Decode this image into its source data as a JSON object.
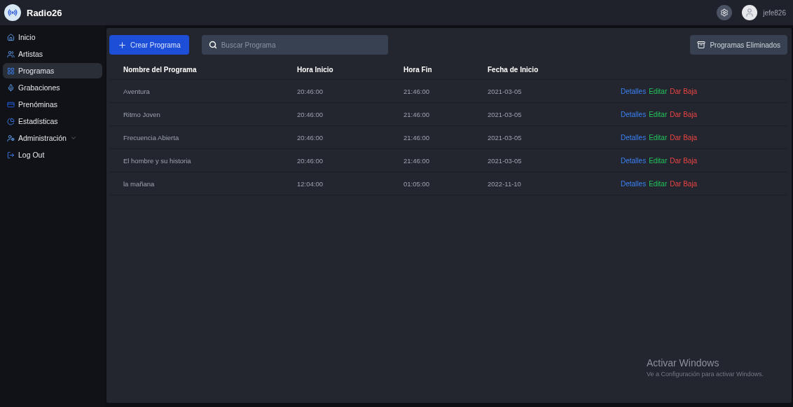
{
  "app": {
    "title": "Radio26"
  },
  "user": {
    "name": "jefe826"
  },
  "sidebar": {
    "items": [
      {
        "label": "Inicio",
        "selected": false
      },
      {
        "label": "Artistas",
        "selected": false
      },
      {
        "label": "Programas",
        "selected": true
      },
      {
        "label": "Grabaciones",
        "selected": false
      },
      {
        "label": "Prenóminas",
        "selected": false
      },
      {
        "label": "Estadísticas",
        "selected": false
      },
      {
        "label": "Administración",
        "selected": false,
        "expandable": true
      },
      {
        "label": "Log Out",
        "selected": false
      }
    ]
  },
  "toolbar": {
    "create_button": "Crear Programa",
    "search": {
      "placeholder": "Buscar Programa"
    },
    "deleted_button": "Programas Eliminados"
  },
  "table": {
    "columns": [
      "Nombre del Programa",
      "Hora Inicio",
      "Hora Fin",
      "Fecha de Inicio"
    ],
    "rows": [
      {
        "cells": [
          "Aventura",
          "20:46:00",
          "21:46:00",
          "2021-03-05"
        ],
        "actions": [
          "Detalles",
          "Editar",
          "Dar Baja"
        ]
      },
      {
        "cells": [
          "Ritmo Joven",
          "20:46:00",
          "21:46:00",
          "2021-03-05"
        ],
        "actions": [
          "Detalles",
          "Editar",
          "Dar Baja"
        ]
      },
      {
        "cells": [
          "Frecuencia Abierta",
          "20:46:00",
          "21:46:00",
          "2021-03-05"
        ],
        "actions": [
          "Detalles",
          "Editar",
          "Dar Baja"
        ]
      },
      {
        "cells": [
          "El hombre y su historia",
          "20:46:00",
          "21:46:00",
          "2021-03-05"
        ],
        "actions": [
          "Detalles",
          "Editar",
          "Dar Baja"
        ]
      },
      {
        "cells": [
          "la mañana",
          "12:04:00",
          "01:05:00",
          "2022-11-10"
        ],
        "actions": [
          "Detalles",
          "Editar",
          "Dar Baja"
        ]
      }
    ]
  },
  "os_notice": {
    "title": "Activar Windows",
    "text": "Ve a Configuración para activar Windows."
  }
}
